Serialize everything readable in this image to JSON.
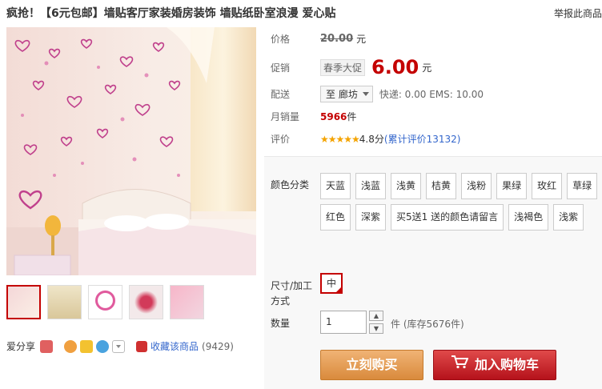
{
  "header": {
    "title": "疯抢！【6元包邮】墙贴客厅家装婚房装饰 墙贴纸卧室浪漫 爱心贴",
    "report_link": "举报此商品"
  },
  "gallery": {
    "thumbnails": [
      "thumb-1",
      "thumb-2",
      "thumb-3",
      "thumb-4",
      "thumb-5"
    ]
  },
  "share": {
    "label": "爱分享",
    "favorite_label": "收藏该商品",
    "favorite_count": "(9429)"
  },
  "details": {
    "price_label": "价格",
    "original_price": "20.00",
    "currency": "元",
    "promo_label": "促销",
    "promo_tag": "春季大促",
    "promo_price": "6.00",
    "shipping_label": "配送",
    "shipping_to": "至 廊坊",
    "shipping_info": "快递: 0.00 EMS: 10.00",
    "sales_label": "月销量",
    "sales_count": "5966",
    "sales_unit": "件",
    "rating_label": "评价",
    "rating_stars": "★★★★★",
    "rating_score": "4.8分",
    "rating_link": "(累计评价13132)"
  },
  "sku": {
    "color_label": "颜色分类",
    "colors": [
      "天蓝",
      "浅蓝",
      "浅黄",
      "桔黄",
      "浅粉",
      "果绿",
      "玫红",
      "草绿",
      "红色",
      "深紫",
      "买5送1 送的颜色请留言",
      "浅褐色",
      "浅紫"
    ],
    "size_label_1": "尺寸/加工",
    "size_label_2": "方式",
    "size_value": "中",
    "qty_label": "数量",
    "qty_value": "1",
    "stock_text": "件 (库存5676件)"
  },
  "actions": {
    "buy_now": "立刻购买",
    "add_to_cart": "加入购物车"
  },
  "colors": {
    "accent": "#c40000",
    "buy_button": "#d98a3c",
    "cart_button": "#b5121b"
  }
}
